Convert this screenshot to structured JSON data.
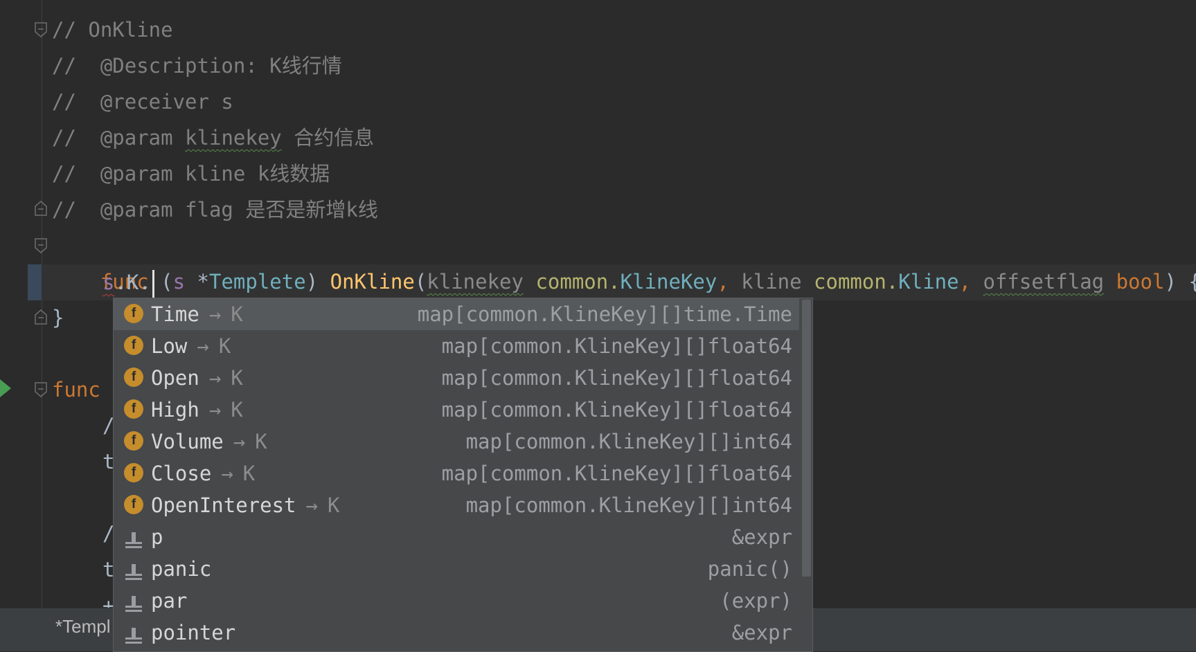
{
  "editor": {
    "lines": {
      "l1": "// OnKline",
      "l2_prefix": "//  @Description: ",
      "l2_text": "K线行情",
      "l3": "//  @receiver s",
      "l4_prefix": "//  @param ",
      "l4_param": "klinekey",
      "l4_text": " 合约信息",
      "l5_prefix": "//  @param kline ",
      "l5_text": "k线数据",
      "l6_prefix": "//  @param flag ",
      "l6_text": "是否是新增k线",
      "l7": {
        "func": "func",
        "open": " (",
        "recv": "s",
        "star": " *",
        "recv_type": "Templete",
        "close": ") ",
        "name": "OnKline",
        "paren": "(",
        "p1": "klinekey",
        "p1_pkg": " common.",
        "p1_type": "KlineKey",
        "comma1": ", ",
        "p2": "kline",
        "p2_pkg": " common.",
        "p2_type": "Kline",
        "comma2": ", ",
        "p3": "offsetflag",
        "p3_type": " bool",
        "end": ") {"
      },
      "l8_recv": "s",
      "l8_dot": ".K.",
      "l9": "}",
      "l10": "func",
      "partial1": "/",
      "partial2": "t",
      "partial3": "/",
      "partial4": "t",
      "partial5": "+"
    }
  },
  "completion": {
    "items": [
      {
        "icon": "field-icon",
        "name": "Time",
        "arrow": "→",
        "owner": "K",
        "type": "map[common.KlineKey][]time.Time"
      },
      {
        "icon": "field-icon",
        "name": "Low",
        "arrow": "→",
        "owner": "K",
        "type": "map[common.KlineKey][]float64"
      },
      {
        "icon": "field-icon",
        "name": "Open",
        "arrow": "→",
        "owner": "K",
        "type": "map[common.KlineKey][]float64"
      },
      {
        "icon": "field-icon",
        "name": "High",
        "arrow": "→",
        "owner": "K",
        "type": "map[common.KlineKey][]float64"
      },
      {
        "icon": "field-icon",
        "name": "Volume",
        "arrow": "→",
        "owner": "K",
        "type": "map[common.KlineKey][]int64"
      },
      {
        "icon": "field-icon",
        "name": "Close",
        "arrow": "→",
        "owner": "K",
        "type": "map[common.KlineKey][]float64"
      },
      {
        "icon": "field-icon",
        "name": "OpenInterest",
        "arrow": "→",
        "owner": "K",
        "type": "map[common.KlineKey][]int64"
      },
      {
        "icon": "template-icon",
        "name": "p",
        "arrow": "",
        "owner": "",
        "type": "&expr"
      },
      {
        "icon": "template-icon",
        "name": "panic",
        "arrow": "",
        "owner": "",
        "type": "panic()"
      },
      {
        "icon": "template-icon",
        "name": "par",
        "arrow": "",
        "owner": "",
        "type": "(expr)"
      },
      {
        "icon": "template-icon",
        "name": "pointer",
        "arrow": "",
        "owner": "",
        "type": "&expr"
      }
    ],
    "field_icon_letter": "f"
  },
  "statusbar": {
    "tab_label": "*Templ"
  },
  "colors": {
    "background": "#2b2b2b",
    "popup": "#46484a",
    "selected": "#55595c",
    "field_icon": "#c58d2c"
  }
}
